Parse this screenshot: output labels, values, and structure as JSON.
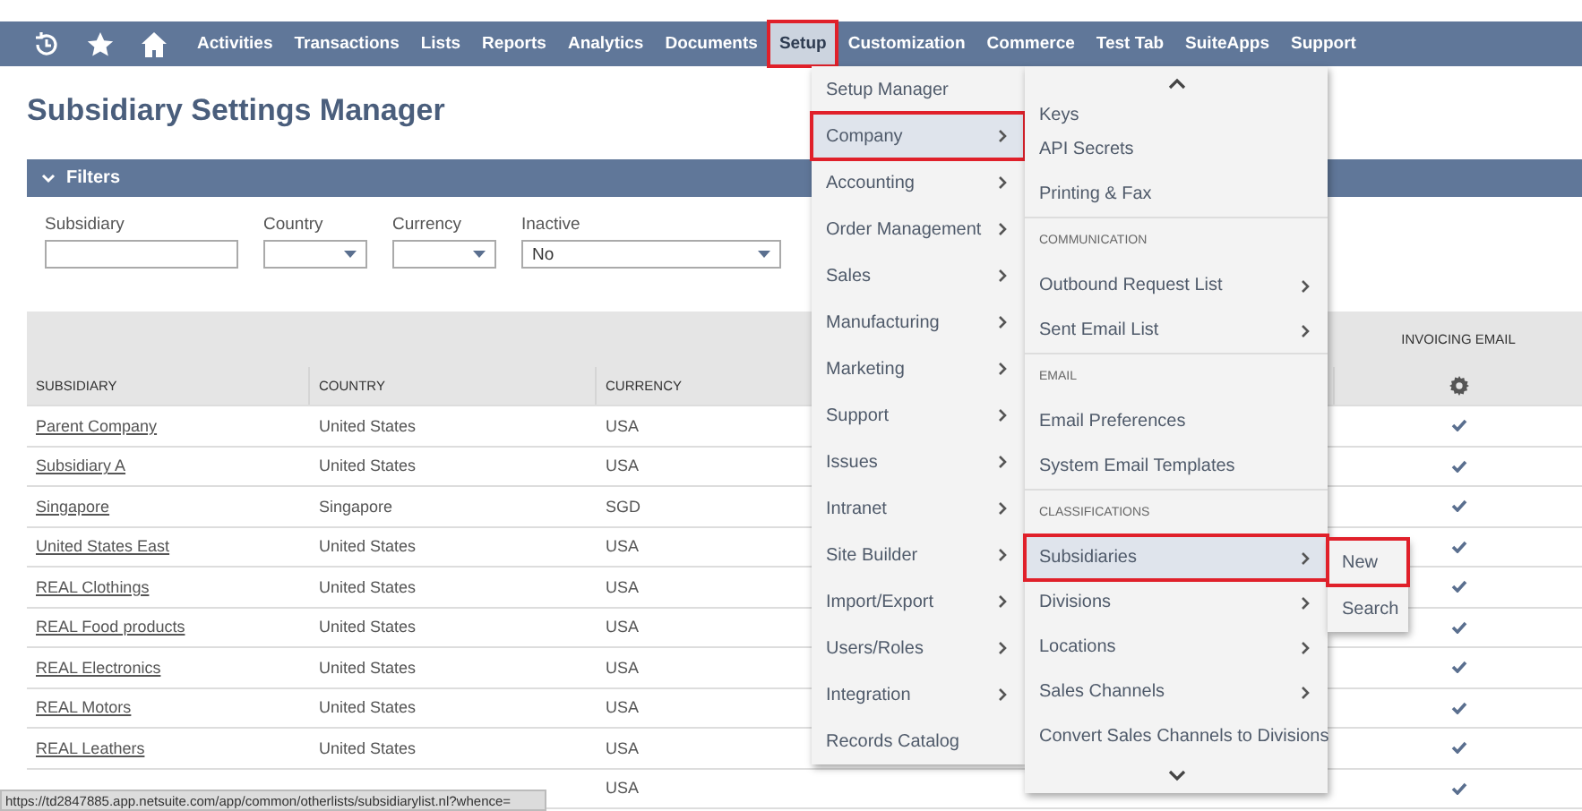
{
  "nav": {
    "items": [
      {
        "label": "Activities",
        "selected": false,
        "highlighted": false
      },
      {
        "label": "Transactions",
        "selected": false,
        "highlighted": false
      },
      {
        "label": "Lists",
        "selected": false,
        "highlighted": false
      },
      {
        "label": "Reports",
        "selected": false,
        "highlighted": false
      },
      {
        "label": "Analytics",
        "selected": false,
        "highlighted": false
      },
      {
        "label": "Documents",
        "selected": false,
        "highlighted": false
      },
      {
        "label": "Setup",
        "selected": true,
        "highlighted": true
      },
      {
        "label": "Customization",
        "selected": false,
        "highlighted": false
      },
      {
        "label": "Commerce",
        "selected": false,
        "highlighted": false
      },
      {
        "label": "Test Tab",
        "selected": false,
        "highlighted": false
      },
      {
        "label": "SuiteApps",
        "selected": false,
        "highlighted": false
      },
      {
        "label": "Support",
        "selected": false,
        "highlighted": false
      }
    ]
  },
  "page_title": "Subsidiary Settings Manager",
  "filters": {
    "label": "Filters",
    "expanded": true,
    "fields": [
      {
        "kind": "text",
        "label": "Subsidiary"
      },
      {
        "kind": "select",
        "label": "Country"
      },
      {
        "kind": "select",
        "label": "Currency"
      },
      {
        "kind": "select",
        "label": "Inactive",
        "value": "No"
      }
    ]
  },
  "table": {
    "group_header": "INVOICING EMAIL",
    "columns": [
      "SUBSIDIARY",
      "COUNTRY",
      "CURRENCY"
    ],
    "rows": [
      {
        "subsidiary": "Parent Company",
        "country": "United States",
        "currency": "USA",
        "invoicing_email": true
      },
      {
        "subsidiary": "Subsidiary A",
        "country": "United States",
        "currency": "USA",
        "invoicing_email": true
      },
      {
        "subsidiary": "Singapore",
        "country": "Singapore",
        "currency": "SGD",
        "invoicing_email": true
      },
      {
        "subsidiary": "United States East",
        "country": "United States",
        "currency": "USA",
        "invoicing_email": true
      },
      {
        "subsidiary": "REAL Clothings",
        "country": "United States",
        "currency": "USA",
        "invoicing_email": true
      },
      {
        "subsidiary": "REAL Food products",
        "country": "United States",
        "currency": "USA",
        "invoicing_email": true
      },
      {
        "subsidiary": "REAL Electronics",
        "country": "United States",
        "currency": "USA",
        "invoicing_email": true
      },
      {
        "subsidiary": "REAL Motors",
        "country": "United States",
        "currency": "USA",
        "invoicing_email": true
      },
      {
        "subsidiary": "REAL Leathers",
        "country": "United States",
        "currency": "USA",
        "invoicing_email": true
      },
      {
        "currency": "USA",
        "invoicing_email": true
      }
    ]
  },
  "setup_menu": {
    "items": [
      {
        "label": "Setup Manager",
        "submenu": false,
        "selected": false,
        "highlighted": false
      },
      {
        "label": "Company",
        "submenu": true,
        "selected": true,
        "highlighted": true
      },
      {
        "label": "Accounting",
        "submenu": true,
        "selected": false,
        "highlighted": false
      },
      {
        "label": "Order Management",
        "submenu": true,
        "selected": false,
        "highlighted": false
      },
      {
        "label": "Sales",
        "submenu": true,
        "selected": false,
        "highlighted": false
      },
      {
        "label": "Manufacturing",
        "submenu": true,
        "selected": false,
        "highlighted": false
      },
      {
        "label": "Marketing",
        "submenu": true,
        "selected": false,
        "highlighted": false
      },
      {
        "label": "Support",
        "submenu": true,
        "selected": false,
        "highlighted": false
      },
      {
        "label": "Issues",
        "submenu": true,
        "selected": false,
        "highlighted": false
      },
      {
        "label": "Intranet",
        "submenu": true,
        "selected": false,
        "highlighted": false
      },
      {
        "label": "Site Builder",
        "submenu": true,
        "selected": false,
        "highlighted": false
      },
      {
        "label": "Import/Export",
        "submenu": true,
        "selected": false,
        "highlighted": false
      },
      {
        "label": "Users/Roles",
        "submenu": true,
        "selected": false,
        "highlighted": false
      },
      {
        "label": "Integration",
        "submenu": true,
        "selected": false,
        "highlighted": false
      },
      {
        "label": "Records Catalog",
        "submenu": false,
        "selected": false,
        "highlighted": false
      }
    ]
  },
  "company_menu": {
    "items": [
      {
        "kind": "item",
        "label": "Keys",
        "submenu": false,
        "selected": false,
        "highlighted": false
      },
      {
        "kind": "item",
        "label": "API Secrets",
        "submenu": false,
        "selected": false,
        "highlighted": false
      },
      {
        "kind": "item",
        "label": "Printing & Fax",
        "submenu": false,
        "selected": false,
        "highlighted": false
      },
      {
        "kind": "header",
        "label": "COMMUNICATION"
      },
      {
        "kind": "item",
        "label": "Outbound Request List",
        "submenu": true,
        "selected": false,
        "highlighted": false
      },
      {
        "kind": "item",
        "label": "Sent Email List",
        "submenu": true,
        "selected": false,
        "highlighted": false
      },
      {
        "kind": "header",
        "label": "EMAIL"
      },
      {
        "kind": "item",
        "label": "Email Preferences",
        "submenu": false,
        "selected": false,
        "highlighted": false
      },
      {
        "kind": "item",
        "label": "System Email Templates",
        "submenu": false,
        "selected": false,
        "highlighted": false
      },
      {
        "kind": "header",
        "label": "CLASSIFICATIONS"
      },
      {
        "kind": "item",
        "label": "Subsidiaries",
        "submenu": true,
        "selected": true,
        "highlighted": true
      },
      {
        "kind": "item",
        "label": "Divisions",
        "submenu": true,
        "selected": false,
        "highlighted": false
      },
      {
        "kind": "item",
        "label": "Locations",
        "submenu": true,
        "selected": false,
        "highlighted": false
      },
      {
        "kind": "item",
        "label": "Sales Channels",
        "submenu": true,
        "selected": false,
        "highlighted": false
      },
      {
        "kind": "item",
        "label": "Convert Sales Channels to Divisions",
        "submenu": false,
        "selected": false,
        "highlighted": false
      }
    ]
  },
  "subsidiaries_menu": {
    "items": [
      {
        "label": "New",
        "highlighted": true
      },
      {
        "label": "Search",
        "highlighted": false
      }
    ]
  },
  "status_bar": {
    "url": "https://td2847885.app.netsuite.com/app/common/otherlists/subsidiarylist.nl?whence="
  }
}
